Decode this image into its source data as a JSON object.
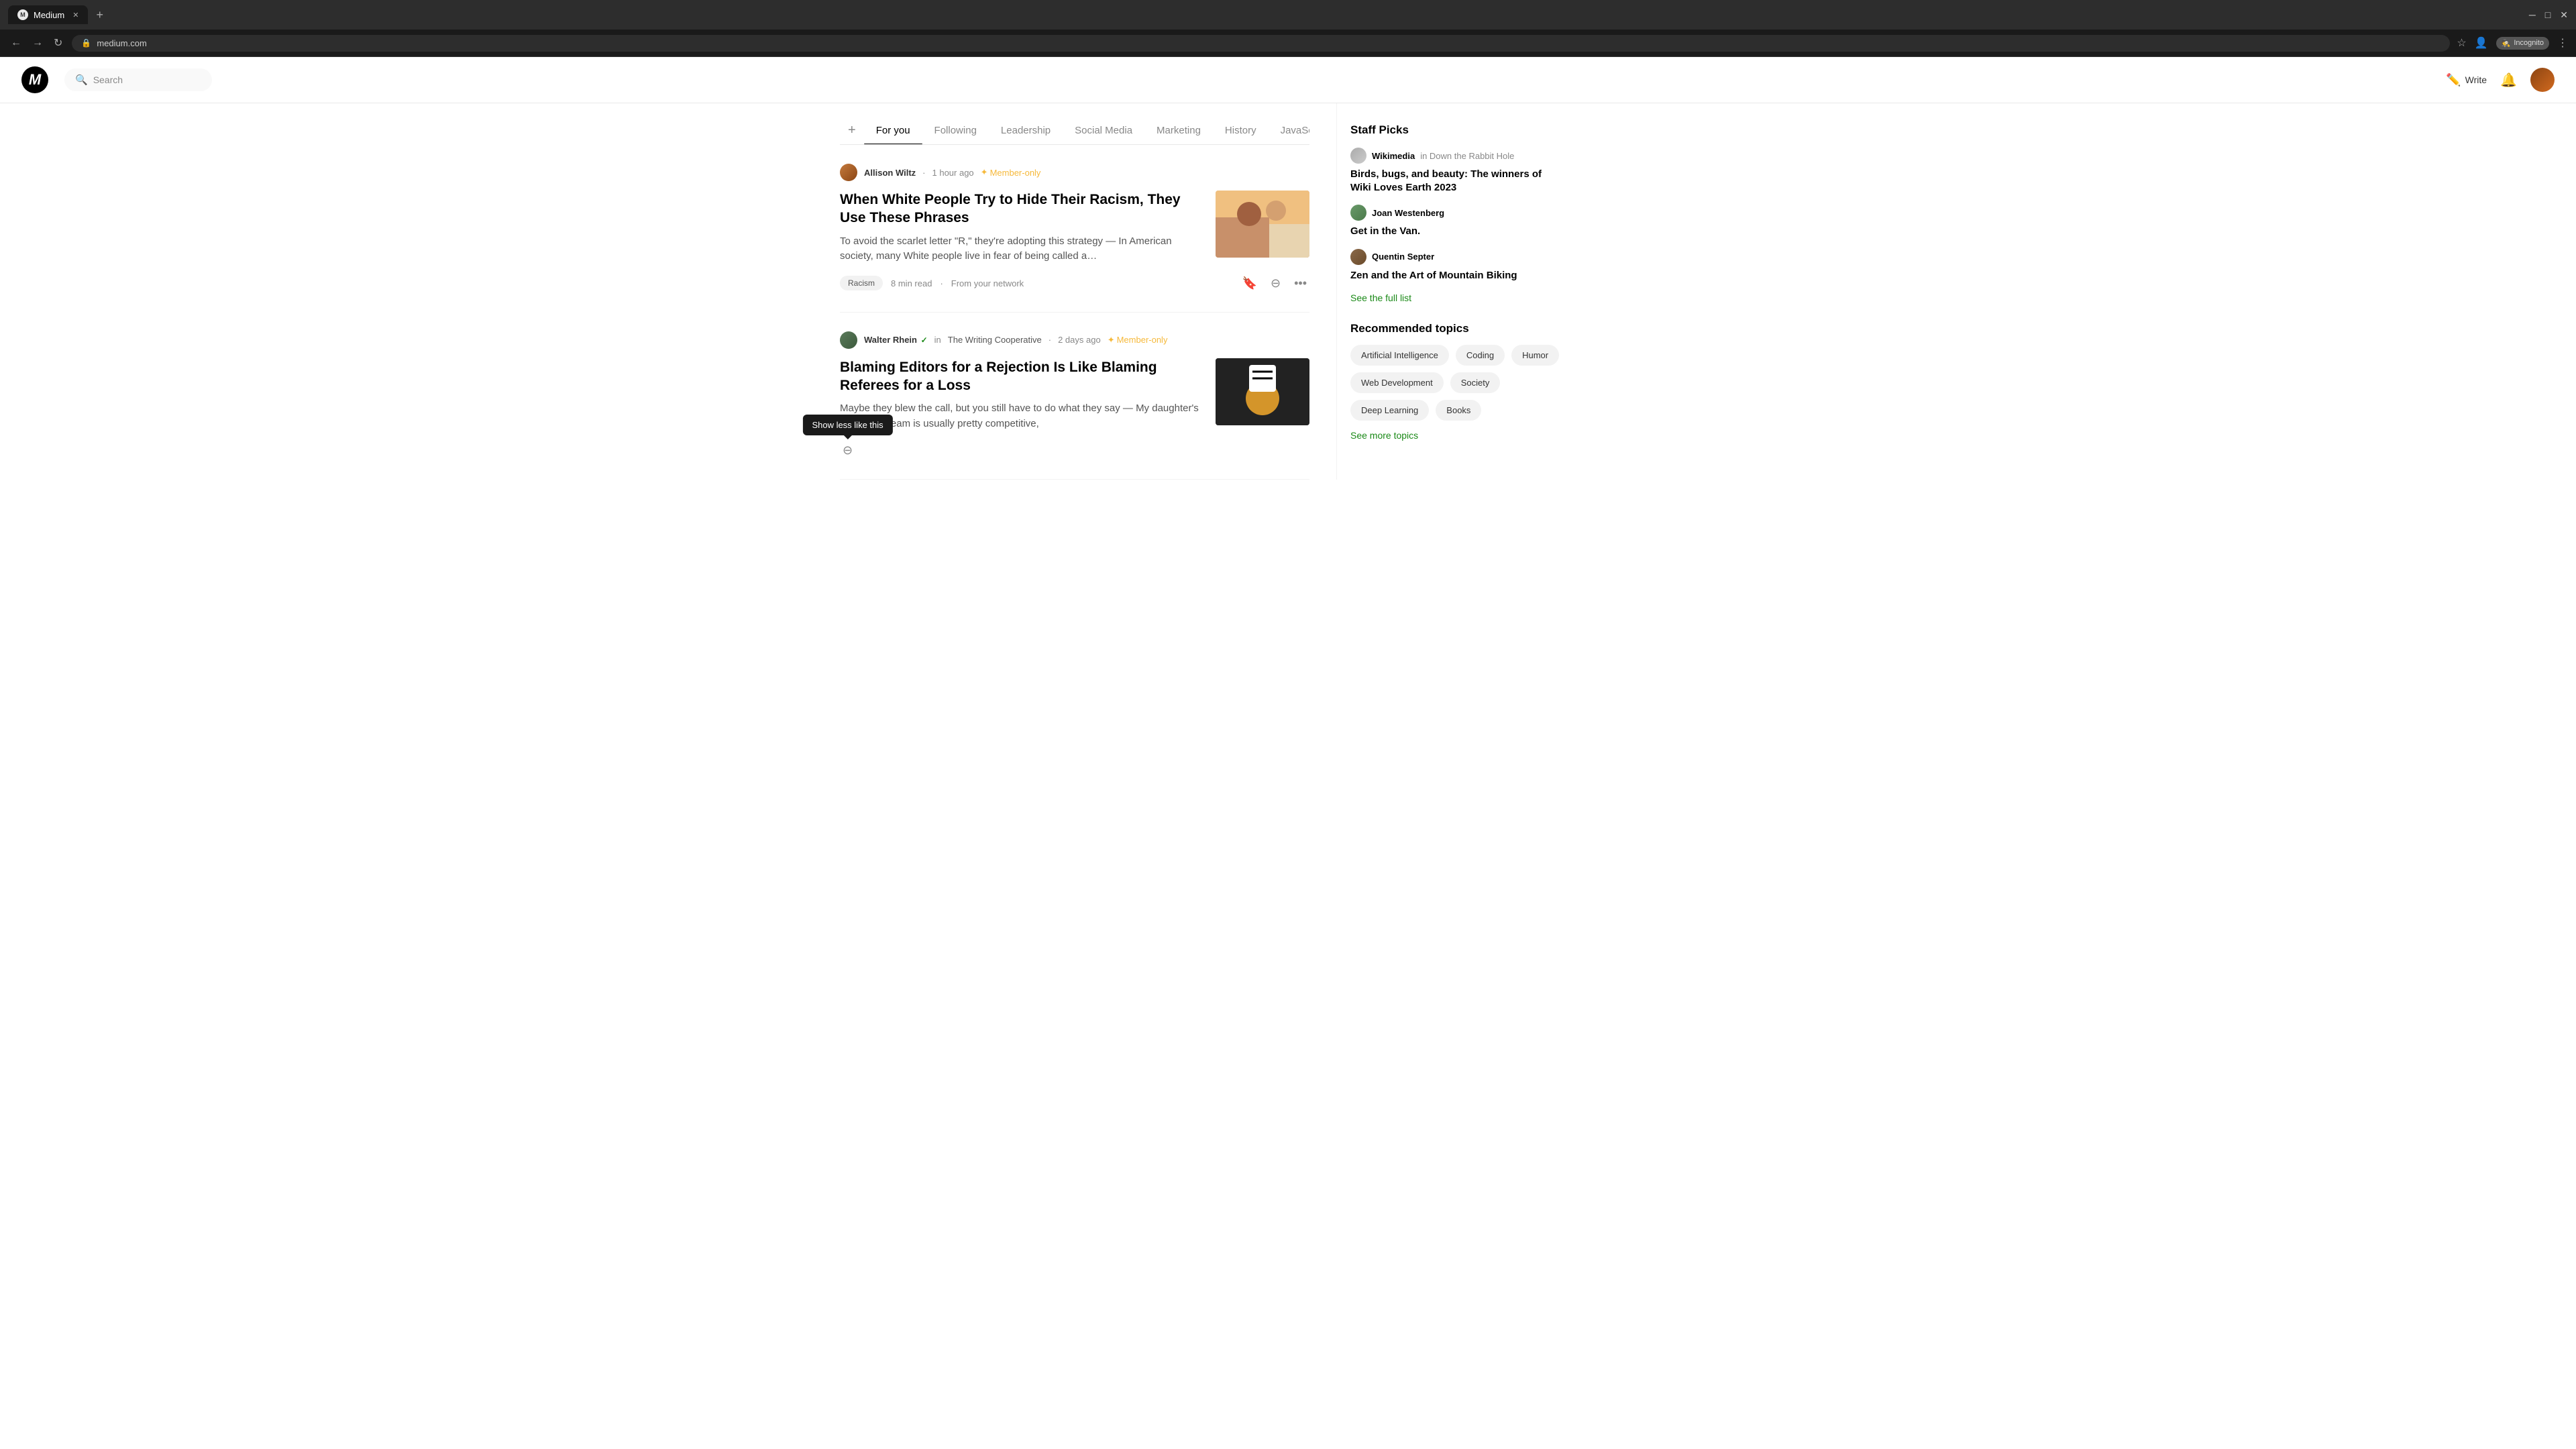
{
  "browser": {
    "tab_title": "Medium",
    "url": "medium.com",
    "new_tab_label": "+",
    "incognito_label": "Incognito"
  },
  "header": {
    "logo_text": "M",
    "search_placeholder": "Search",
    "write_label": "Write",
    "notification_icon": "🔔"
  },
  "tabs": {
    "add_label": "+",
    "items": [
      {
        "id": "for-you",
        "label": "For you",
        "active": true
      },
      {
        "id": "following",
        "label": "Following",
        "active": false
      },
      {
        "id": "leadership",
        "label": "Leadership",
        "active": false
      },
      {
        "id": "social-media",
        "label": "Social Media",
        "active": false
      },
      {
        "id": "marketing",
        "label": "Marketing",
        "active": false
      },
      {
        "id": "history",
        "label": "History",
        "active": false
      },
      {
        "id": "javascript",
        "label": "JavaSc…",
        "active": false
      }
    ]
  },
  "articles": [
    {
      "id": "racism",
      "author_name": "Allison Wiltz",
      "time_ago": "1 hour ago",
      "member_only": "Member-only",
      "title": "When White People Try to Hide Their Racism, They Use These Phrases",
      "excerpt": "To avoid the scarlet letter \"R,\" they're adopting this strategy — In American society, many White people live in fear of being called a…",
      "tag": "Racism",
      "read_time": "8 min read",
      "network_label": "From your network",
      "has_verified": false
    },
    {
      "id": "editors",
      "author_name": "Walter Rhein",
      "author_in": "in",
      "pub_name": "The Writing Cooperative",
      "time_ago": "2 days ago",
      "member_only": "Member-only",
      "title": "Blaming Editors for a Rejection Is Like Blaming Referees for a Loss",
      "excerpt": "Maybe they blew the call, but you still have to do what they say — My daughter's basketball team is usually pretty competitive,",
      "has_verified": true
    }
  ],
  "tooltip": {
    "label": "Show less like this"
  },
  "sidebar": {
    "staff_picks_title": "Staff Picks",
    "picks": [
      {
        "author": "Wikimedia",
        "pub": "in Down the Rabbit Hole",
        "title": "Birds, bugs, and beauty: The winners of Wiki Loves Earth 2023"
      },
      {
        "author": "Joan Westenberg",
        "pub": "",
        "title": "Get in the Van."
      },
      {
        "author": "Quentin Septer",
        "pub": "",
        "title": "Zen and the Art of Mountain Biking"
      }
    ],
    "see_full_list": "See the full list",
    "rec_topics_title": "Recommended topics",
    "topics": [
      "Artificial Intelligence",
      "Coding",
      "Humor",
      "Web Development",
      "Society",
      "Deep Learning",
      "Books"
    ],
    "see_more_topics": "See more topics"
  }
}
